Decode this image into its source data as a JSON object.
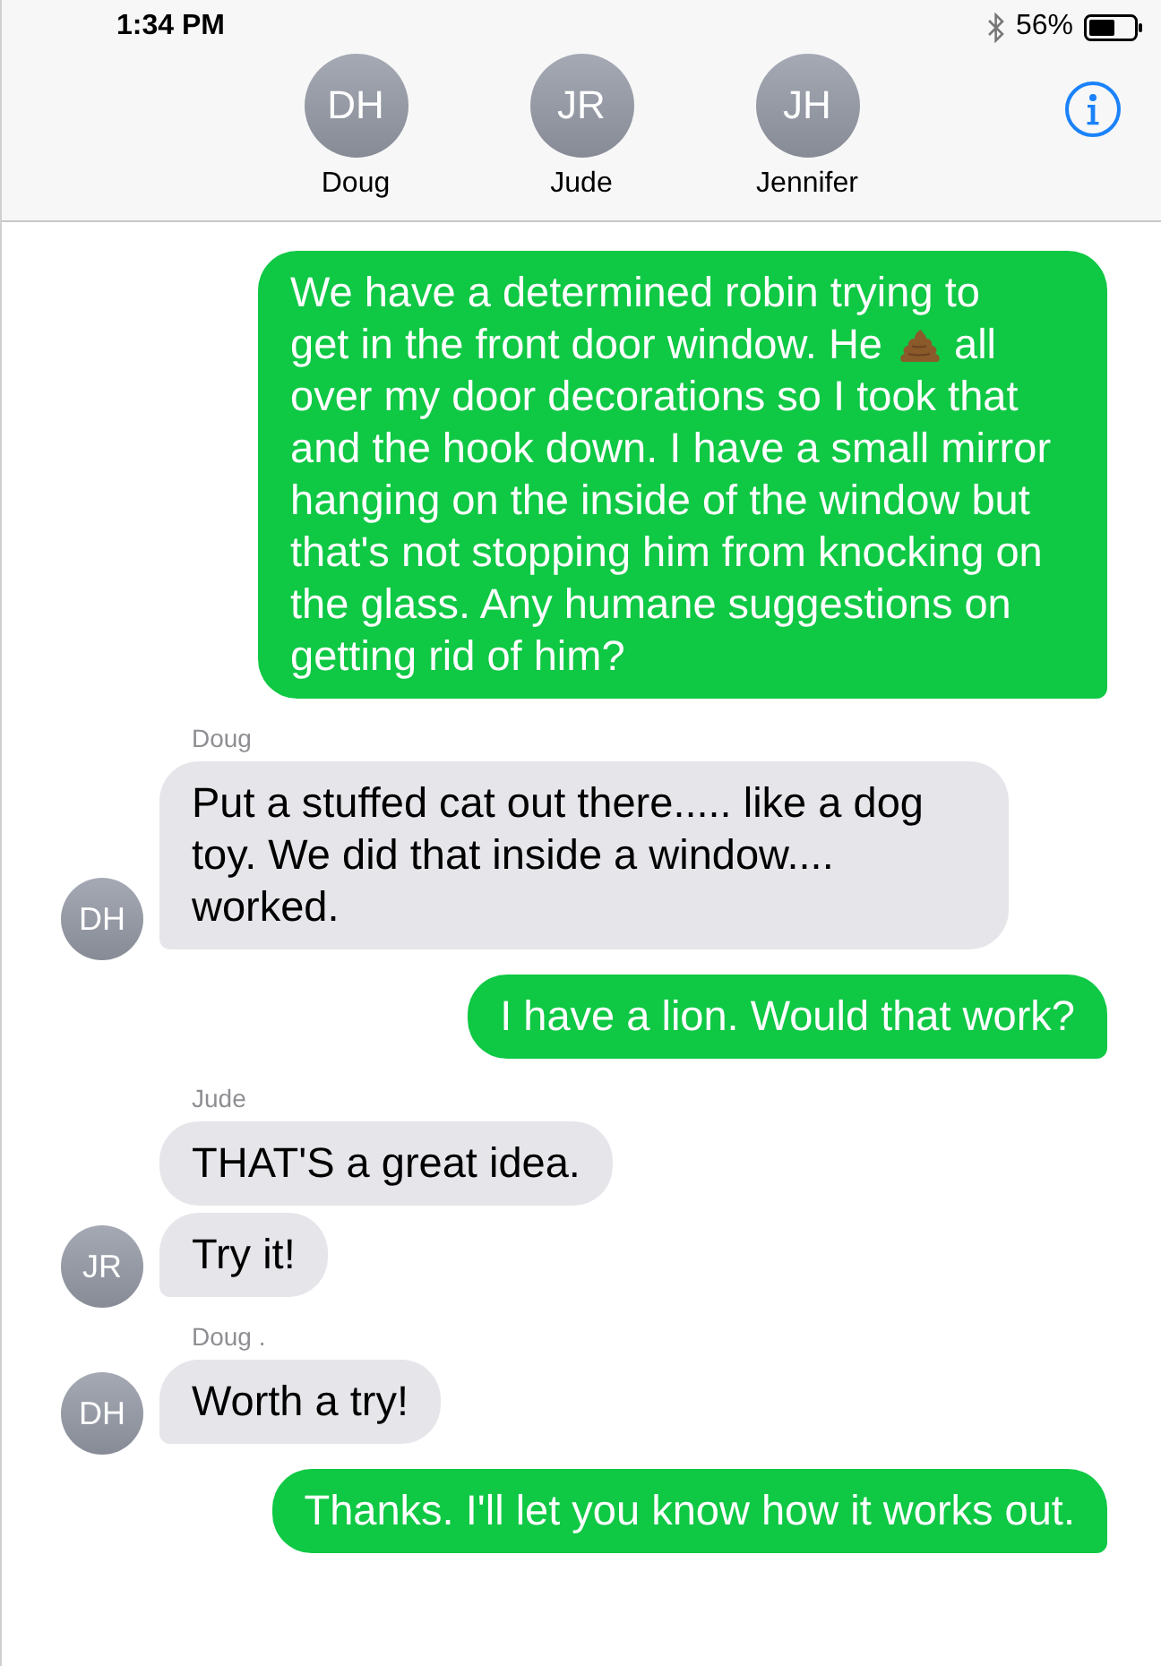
{
  "status_bar": {
    "time": "1:34 PM",
    "battery": "56%"
  },
  "participants": [
    {
      "initials": "DH",
      "name": "Doug"
    },
    {
      "initials": "JR",
      "name": "Jude"
    },
    {
      "initials": "JH",
      "name": "Jennifer"
    }
  ],
  "groups": [
    {
      "kind": "outgoing",
      "bubbles": [
        {
          "parts": [
            {
              "kind": "paragraph",
              "text": "We have a determined robin trying to"
            },
            {
              "kind": "inline",
              "text": "get in the front door window. He"
            },
            {
              "kind": "poop-emoji"
            },
            {
              "kind": "inline",
              "text": "all"
            },
            {
              "kind": "paragraph",
              "text": "over my door decorations so I took that and the hook down. I have a small mirror hanging on the inside of the window but that's not stopping him from knocking on the glass. Any humane suggestions on getting rid of him?"
            }
          ]
        }
      ]
    },
    {
      "kind": "incoming",
      "sender": "Doug",
      "avatar": "DH",
      "bubbles": [
        {
          "parts": [
            {
              "kind": "paragraph",
              "text": "Put a stuffed cat out there..... like a dog toy. We did that inside a window.... worked."
            }
          ]
        }
      ]
    },
    {
      "kind": "outgoing",
      "bubbles": [
        {
          "parts": [
            {
              "kind": "paragraph",
              "text": "I have a lion. Would that work?"
            }
          ]
        }
      ]
    },
    {
      "kind": "incoming",
      "sender": "Jude",
      "avatar": "JR",
      "bubbles": [
        {
          "parts": [
            {
              "kind": "paragraph",
              "text": "THAT'S a great idea."
            }
          ]
        },
        {
          "parts": [
            {
              "kind": "paragraph",
              "text": "Try it!"
            }
          ]
        }
      ]
    },
    {
      "kind": "incoming",
      "sender": "Doug .",
      "avatar": "DH",
      "bubbles": [
        {
          "parts": [
            {
              "kind": "paragraph",
              "text": "Worth a try!"
            }
          ]
        }
      ]
    },
    {
      "kind": "outgoing",
      "bubbles": [
        {
          "parts": [
            {
              "kind": "paragraph",
              "text": "Thanks. I'll let you know how it works out."
            }
          ]
        }
      ]
    }
  ]
}
